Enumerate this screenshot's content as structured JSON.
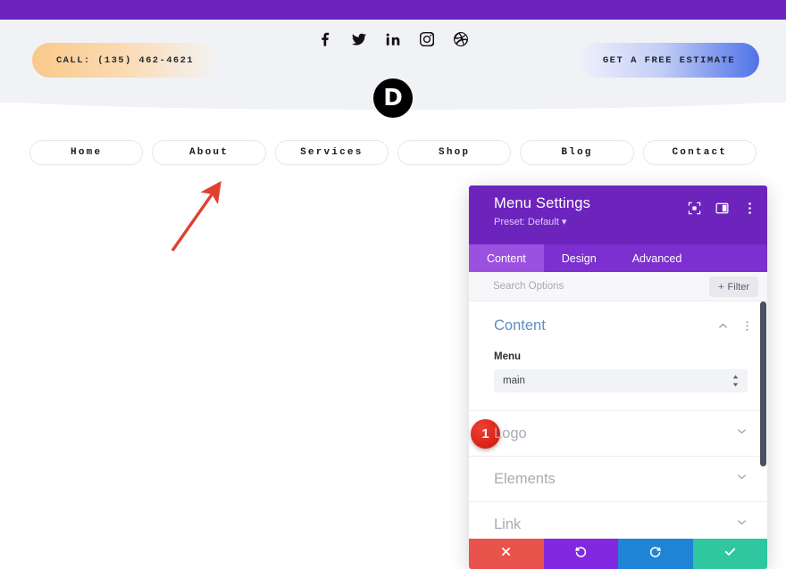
{
  "site": {
    "call_button": "CALL: (135) 462-4621",
    "estimate_button": "GET A FREE ESTIMATE",
    "logo_letter": "D",
    "social": [
      {
        "name": "facebook-icon",
        "label": "Facebook"
      },
      {
        "name": "twitter-icon",
        "label": "Twitter"
      },
      {
        "name": "linkedin-icon",
        "label": "LinkedIn"
      },
      {
        "name": "instagram-icon",
        "label": "Instagram"
      },
      {
        "name": "dribbble-icon",
        "label": "Dribbble"
      }
    ],
    "nav": [
      "Home",
      "About",
      "Services",
      "Shop",
      "Blog",
      "Contact"
    ]
  },
  "panel": {
    "title": "Menu Settings",
    "preset": "Preset: Default",
    "header_icons": [
      "focus-target-icon",
      "panel-layout-icon",
      "more-options-icon"
    ],
    "tabs": [
      {
        "label": "Content",
        "active": true
      },
      {
        "label": "Design",
        "active": false
      },
      {
        "label": "Advanced",
        "active": false
      }
    ],
    "search_placeholder": "Search Options",
    "search_value": "",
    "filter_label": "Filter",
    "content_section": {
      "title": "Content",
      "badge": "1",
      "field_label": "Menu",
      "select_value": "main",
      "select_options": [
        "main"
      ]
    },
    "collapsed_sections": [
      "Logo",
      "Elements",
      "Link"
    ],
    "footer_buttons": [
      {
        "name": "cancel-button",
        "icon": "close-icon"
      },
      {
        "name": "undo-button",
        "icon": "undo-icon"
      },
      {
        "name": "redo-button",
        "icon": "redo-icon"
      },
      {
        "name": "save-button",
        "icon": "check-icon"
      }
    ]
  },
  "colors": {
    "purple": "#6c24bd",
    "tab_active": "#9b51e0",
    "badge_red": "#d81e12",
    "save_green": "#2ec7a0",
    "cancel_red": "#e8534c",
    "redo_blue": "#1f84d6",
    "section_blue": "#5f8ec4",
    "annotation_red": "#e0412f"
  }
}
